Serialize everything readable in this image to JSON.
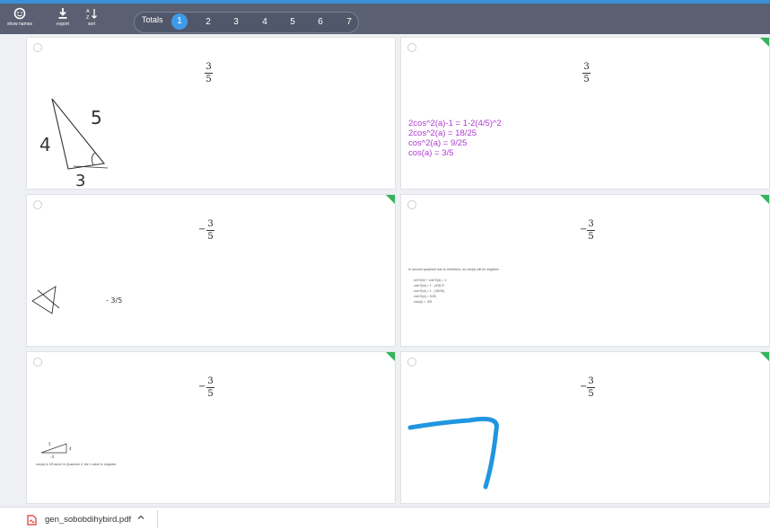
{
  "toolbar": {
    "show_names": "show names",
    "export": "export",
    "sort": "sort",
    "totals": "Totals",
    "pages": [
      "1",
      "2",
      "3",
      "4",
      "5",
      "6",
      "7"
    ],
    "active_page": "1"
  },
  "cards": [
    {
      "answer_sign": "",
      "num": "3",
      "den": "5",
      "handwriting": [
        "5",
        "4",
        "3"
      ]
    },
    {
      "answer_sign": "",
      "num": "3",
      "den": "5",
      "work_lines": [
        "2cos^2(a)-1 = 1-2(4/5)^2",
        "2cos^2(a) = 18/25",
        "cos^2(a) = 9/25",
        "cos(a) = 3/5"
      ]
    },
    {
      "answer_sign": "−",
      "num": "3",
      "den": "5",
      "handwriting": [
        "- 3/5"
      ]
    },
    {
      "answer_sign": "−",
      "num": "3",
      "den": "5",
      "work_lines": [
        "In second quadrant due to restriction, so cos(a) will be negative.",
        "sin^2(a) + cos^2(a) = 1",
        "cos^2(a) = 1 - (4/5)^2",
        "cos^2(a) = 1 - (16/25)",
        "cos^2(a) = 9/25",
        "cos(a) = -3/5"
      ]
    },
    {
      "answer_sign": "−",
      "num": "3",
      "den": "5",
      "handwriting": [
        "5",
        "4",
        "-3"
      ],
      "note": "cos(a) is 3/5 since in Quadrant II, the x value is negative."
    },
    {
      "answer_sign": "−",
      "num": "3",
      "den": "5"
    }
  ],
  "download_bar": {
    "filename": "gen_sobobdihybird.pdf",
    "file_icon": "pdf-icon",
    "expand_icon": "chevron-up-icon"
  },
  "colors": {
    "toolbar": "#5a6072",
    "accent": "#3d9be9",
    "flag": "#34b45a",
    "purple_text": "#b03ad0",
    "stroke_blue": "#2196e0"
  }
}
